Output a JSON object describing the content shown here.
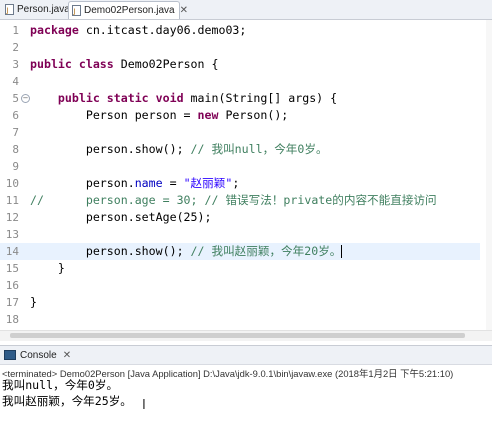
{
  "tabs": [
    {
      "label": "Person.java",
      "active": false
    },
    {
      "label": "Demo02Person.java",
      "active": true,
      "close": "✕"
    }
  ],
  "editor": {
    "lines": [
      {
        "n": "1",
        "segs": [
          {
            "t": "package ",
            "c": "kw"
          },
          {
            "t": "cn.itcast.day06.demo03;",
            "c": ""
          }
        ]
      },
      {
        "n": "2",
        "segs": []
      },
      {
        "n": "3",
        "segs": [
          {
            "t": "public class ",
            "c": "kw"
          },
          {
            "t": "Demo02Person {",
            "c": ""
          }
        ]
      },
      {
        "n": "4",
        "segs": []
      },
      {
        "n": "5",
        "fold": true,
        "segs": [
          {
            "t": "    public static void ",
            "c": "kw"
          },
          {
            "t": "main(String[] args) {",
            "c": ""
          }
        ]
      },
      {
        "n": "6",
        "segs": [
          {
            "t": "        Person person = ",
            "c": ""
          },
          {
            "t": "new ",
            "c": "kw"
          },
          {
            "t": "Person();",
            "c": ""
          }
        ]
      },
      {
        "n": "7",
        "segs": []
      },
      {
        "n": "8",
        "segs": [
          {
            "t": "        person.show(); ",
            "c": ""
          },
          {
            "t": "// 我叫null，今年0岁。",
            "c": "cm"
          }
        ]
      },
      {
        "n": "9",
        "segs": []
      },
      {
        "n": "10",
        "segs": [
          {
            "t": "        person.",
            "c": ""
          },
          {
            "t": "name",
            "c": "fld"
          },
          {
            "t": " = ",
            "c": ""
          },
          {
            "t": "\"赵丽颖\"",
            "c": "str"
          },
          {
            "t": ";",
            "c": ""
          }
        ]
      },
      {
        "n": "11",
        "segs": [
          {
            "t": "//      person.age = 30; // 错误写法！private的内容不能直接访问",
            "c": "cm"
          }
        ]
      },
      {
        "n": "12",
        "segs": [
          {
            "t": "        person.setAge(25);",
            "c": ""
          }
        ]
      },
      {
        "n": "13",
        "segs": []
      },
      {
        "n": "14",
        "current": true,
        "segs": [
          {
            "t": "        person.show(); ",
            "c": ""
          },
          {
            "t": "// 我叫赵丽颖，今年20岁。",
            "c": "cm"
          }
        ]
      },
      {
        "n": "15",
        "segs": [
          {
            "t": "    }",
            "c": ""
          }
        ]
      },
      {
        "n": "16",
        "segs": []
      },
      {
        "n": "17",
        "segs": [
          {
            "t": "}",
            "c": ""
          }
        ]
      },
      {
        "n": "18",
        "segs": []
      }
    ]
  },
  "console": {
    "tab_label": "Console",
    "close": "✕",
    "status": "<terminated> Demo02Person [Java Application] D:\\Java\\jdk-9.0.1\\bin\\javaw.exe (2018年1月2日 下午5:21:10)",
    "output": [
      "我叫null，今年0岁。",
      "我叫赵丽颖，今年25岁。"
    ]
  },
  "colors": {
    "keyword": "#7f0055",
    "comment": "#3f7f5f",
    "string": "#2a00ff",
    "field": "#0000c0",
    "current_line": "#e8f2fe"
  }
}
